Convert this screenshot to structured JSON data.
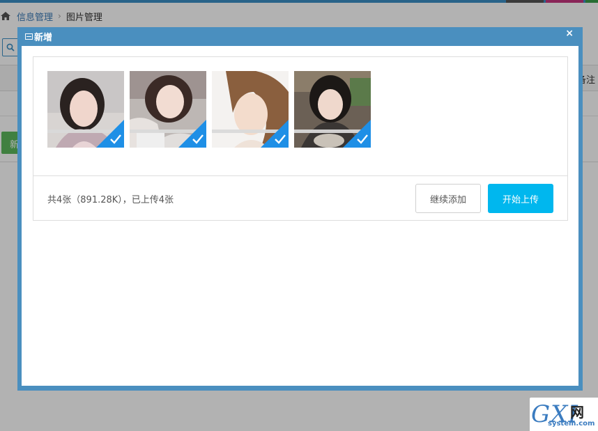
{
  "breadcrumb": {
    "items": [
      "信息管理",
      "图片管理"
    ]
  },
  "background": {
    "table_note_header": "备注",
    "new_button_label": "新"
  },
  "modal": {
    "title": "新增",
    "close_glyph": "×",
    "thumbnails": [
      {
        "alt": "photo-1",
        "status": "uploaded"
      },
      {
        "alt": "photo-2",
        "status": "uploaded"
      },
      {
        "alt": "photo-3",
        "status": "uploaded"
      },
      {
        "alt": "photo-4",
        "status": "uploaded"
      }
    ],
    "status_text": "共4张（891.28K），已上传4张",
    "continue_label": "继续添加",
    "start_label": "开始上传"
  },
  "watermark": {
    "brand": "GXI",
    "brand_cn": "网",
    "domain": "system.com"
  },
  "colors": {
    "modal_header": "#4a8fbf",
    "primary_button": "#00b7ee",
    "check_badge": "#1e8fe6",
    "link": "#3b7cb8"
  },
  "icons": {
    "home": "home-icon",
    "search": "search-icon",
    "check": "check-icon",
    "close": "close-icon",
    "window": "window-icon"
  }
}
